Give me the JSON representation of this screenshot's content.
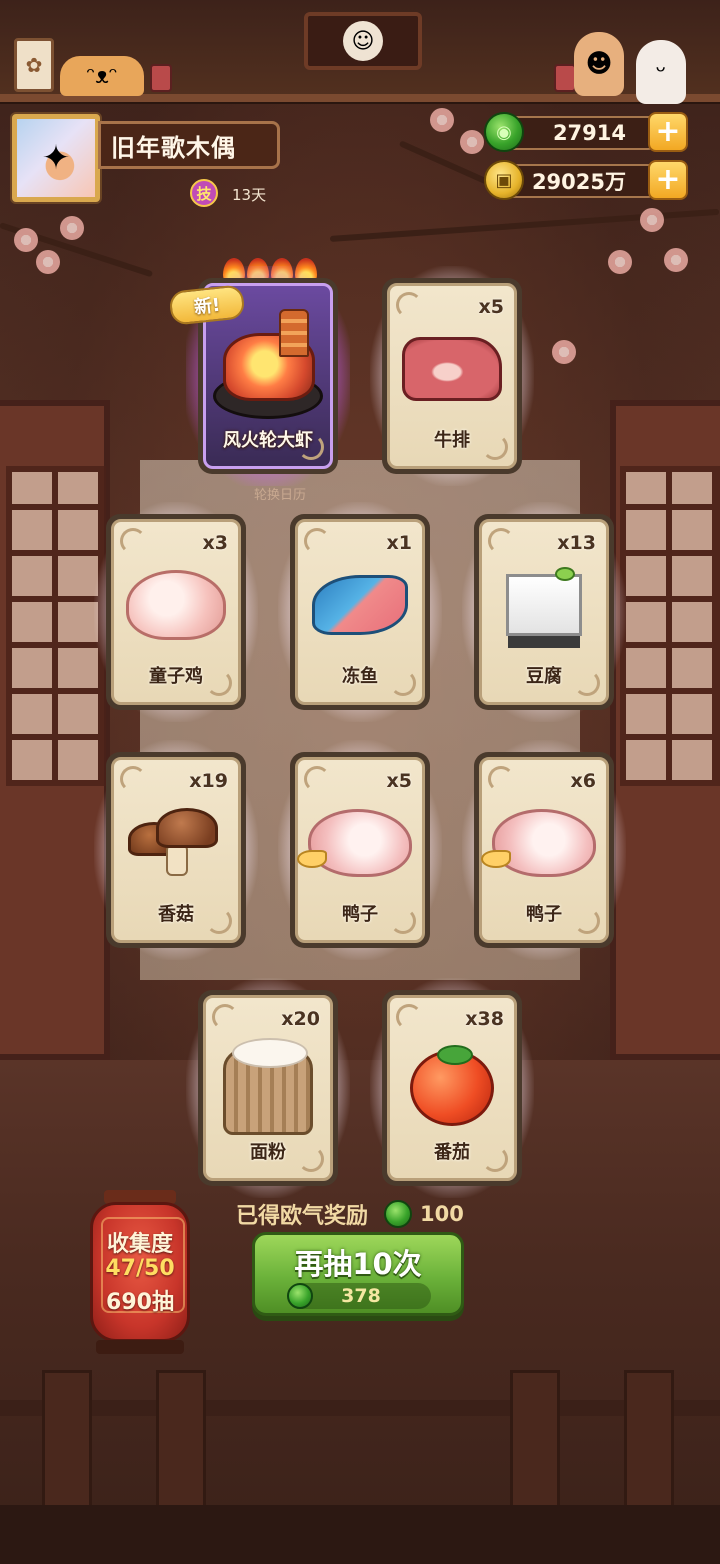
{
  "player": {
    "name": "旧年歌木偶",
    "skill_badge": "技",
    "skill_days": "13天"
  },
  "currency": {
    "jade": "27914",
    "gold": "29025万",
    "plus_label": "+"
  },
  "banner": {
    "calendar_label": "轮换日历",
    "new_tag": "新!"
  },
  "cards": [
    {
      "name": "风火轮大虾",
      "count": "",
      "art": "shrimp-dish",
      "special": true,
      "is_new": true
    },
    {
      "name": "牛排",
      "count": "x5",
      "art": "steak"
    },
    {
      "name": "童子鸡",
      "count": "x3",
      "art": "chicken"
    },
    {
      "name": "冻鱼",
      "count": "x1",
      "art": "fish"
    },
    {
      "name": "豆腐",
      "count": "x13",
      "art": "tofu"
    },
    {
      "name": "香菇",
      "count": "x19",
      "art": "mushroom"
    },
    {
      "name": "鸭子",
      "count": "x5",
      "art": "duck"
    },
    {
      "name": "鸭子",
      "count": "x6",
      "art": "duck"
    },
    {
      "name": "面粉",
      "count": "x20",
      "art": "flour"
    },
    {
      "name": "番茄",
      "count": "x38",
      "art": "tomato"
    }
  ],
  "reward": {
    "label": "已得欧气奖励",
    "value": "100"
  },
  "draw_button": {
    "title": "再抽10次",
    "cost": "378"
  },
  "collection": {
    "label": "收集度",
    "progress": "47/50",
    "total_draws": "690抽"
  },
  "colors": {
    "accent_green": "#6bb23a",
    "special_glow": "#c064ff",
    "card_bg": "#f2e6cc"
  }
}
